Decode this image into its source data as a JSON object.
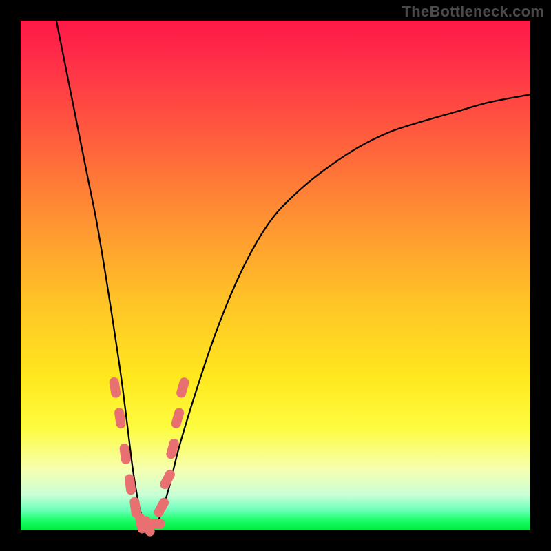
{
  "watermark": "TheBottleneck.com",
  "colors": {
    "frame": "#000000",
    "marker": "#e97070",
    "curve": "#000000"
  },
  "chart_data": {
    "type": "line",
    "title": "",
    "xlabel": "",
    "ylabel": "",
    "xlim": [
      0,
      100
    ],
    "ylim": [
      0,
      100
    ],
    "grid": false,
    "legend_position": "none",
    "annotations": [
      "TheBottleneck.com"
    ],
    "series": [
      {
        "name": "bottleneck-curve",
        "x": [
          7,
          9,
          11,
          13,
          15,
          17,
          19,
          20,
          21,
          22,
          23,
          24,
          25,
          27,
          29,
          31,
          34,
          38,
          42,
          46,
          50,
          55,
          60,
          66,
          72,
          78,
          85,
          92,
          100
        ],
        "y": [
          100,
          90,
          80,
          70,
          60,
          48,
          35,
          28,
          20,
          12,
          6,
          2,
          0.5,
          2,
          8,
          16,
          26,
          38,
          48,
          56,
          62,
          67,
          71,
          75,
          78,
          80,
          82,
          84,
          85.5
        ]
      }
    ],
    "markers": {
      "name": "highlighted-points",
      "comment": "salmon capsule markers near the curve minimum",
      "points": [
        {
          "x": 18.5,
          "y": 28
        },
        {
          "x": 19.5,
          "y": 22
        },
        {
          "x": 20.5,
          "y": 15
        },
        {
          "x": 21.5,
          "y": 9
        },
        {
          "x": 22.5,
          "y": 4.5
        },
        {
          "x": 23.6,
          "y": 1.4
        },
        {
          "x": 25.0,
          "y": 0.8
        },
        {
          "x": 26.3,
          "y": 1.3
        },
        {
          "x": 27.6,
          "y": 4.5
        },
        {
          "x": 28.8,
          "y": 10
        },
        {
          "x": 29.8,
          "y": 16
        },
        {
          "x": 30.8,
          "y": 22
        },
        {
          "x": 31.8,
          "y": 28
        }
      ]
    }
  }
}
